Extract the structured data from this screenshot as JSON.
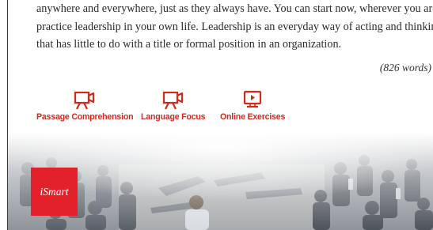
{
  "passage": {
    "lines": [
      "anywhere and everywhere, just as they always have. You can start now, wherever you are, to",
      "practice leadership in your own life. Leadership is an everyday way of acting and thinking",
      "that has little to do with a title or formal position in an organization."
    ],
    "word_count": "(826 words)"
  },
  "resources": [
    {
      "label": "Passage Comprehension",
      "icon": "video-camera-icon"
    },
    {
      "label": "Language Focus",
      "icon": "video-camera-icon"
    },
    {
      "label": "Online Exercises",
      "icon": "monitor-play-icon"
    }
  ],
  "ismart": {
    "label": "iSmart"
  },
  "colors": {
    "accent": "#d7281c",
    "ismart_bg": "#e3212b",
    "text": "#2b2b2b"
  }
}
